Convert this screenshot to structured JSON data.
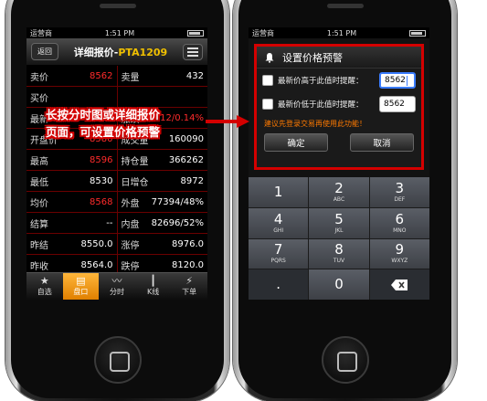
{
  "left_phone": {
    "status": {
      "carrier": "运营商",
      "time": "1:51 PM"
    },
    "header": {
      "back_label": "返回",
      "title_prefix": "详细报价-",
      "title_code": "PTA1209"
    },
    "rows": [
      {
        "l_label": "卖价",
        "l_value": "8562",
        "l_red": true,
        "r_label": "卖量",
        "r_value": "432"
      },
      {
        "l_label": "买价",
        "l_value": "",
        "l_red": false,
        "r_label": "",
        "r_value": ""
      },
      {
        "l_label": "最新",
        "l_value": "8562",
        "l_red": true,
        "r_label": "涨跌",
        "r_value": "12/0.14%"
      },
      {
        "l_label": "开盘价",
        "l_value": "8580",
        "l_red": true,
        "r_label": "成交量",
        "r_value": "160090"
      },
      {
        "l_label": "最高",
        "l_value": "8596",
        "l_red": true,
        "r_label": "持仓量",
        "r_value": "366262"
      },
      {
        "l_label": "最低",
        "l_value": "8530",
        "l_red": false,
        "r_label": "日增仓",
        "r_value": "8972"
      },
      {
        "l_label": "均价",
        "l_value": "8568",
        "l_red": true,
        "r_label": "外盘",
        "r_value": "77394/48%"
      },
      {
        "l_label": "结算",
        "l_value": "--",
        "l_red": false,
        "r_label": "内盘",
        "r_value": "82696/52%"
      },
      {
        "l_label": "昨结",
        "l_value": "8550.0",
        "l_red": false,
        "r_label": "涨停",
        "r_value": "8976.0"
      },
      {
        "l_label": "昨收",
        "l_value": "8564.0",
        "l_red": false,
        "r_label": "跌停",
        "r_value": "8120.0"
      }
    ],
    "tabs": [
      {
        "label": "自选",
        "icon": "star-icon",
        "glyph": "★"
      },
      {
        "label": "盘口",
        "icon": "list-icon",
        "glyph": "▤"
      },
      {
        "label": "分时",
        "icon": "line-chart-icon",
        "glyph": "〰"
      },
      {
        "label": "K线",
        "icon": "candlestick-icon",
        "glyph": "┃"
      },
      {
        "label": "下单",
        "icon": "lightning-icon",
        "glyph": "⚡"
      }
    ],
    "selected_tab": 1
  },
  "callout": {
    "line1": "长按分时图或详细报价",
    "line2": "页面，可设置价格预警"
  },
  "right_phone": {
    "status": {
      "carrier": "运营商",
      "time": "1:51 PM"
    },
    "dialog": {
      "title": "设置价格预警",
      "high_label": "最新价高于此值时提醒：",
      "high_value": "8562",
      "low_label": "最新价低于此值时提醒：",
      "low_value": "8562",
      "warning": "建议先登录交易再使用此功能！",
      "ok_label": "确定",
      "cancel_label": "取消"
    },
    "keys": [
      {
        "num": "1",
        "letters": ""
      },
      {
        "num": "2",
        "letters": "ABC"
      },
      {
        "num": "3",
        "letters": "DEF"
      },
      {
        "num": "4",
        "letters": "GHI"
      },
      {
        "num": "5",
        "letters": "JKL"
      },
      {
        "num": "6",
        "letters": "MNO"
      },
      {
        "num": "7",
        "letters": "PQRS"
      },
      {
        "num": "8",
        "letters": "TUV"
      },
      {
        "num": "9",
        "letters": "WXYZ"
      },
      {
        "num": ".",
        "letters": ""
      },
      {
        "num": "0",
        "letters": ""
      },
      {
        "num": "",
        "letters": ""
      }
    ]
  },
  "colors": {
    "accent_red": "#d40000",
    "price_red": "#ff2b2b",
    "tab_orange": "#f0a020",
    "code_yellow": "#f0c000",
    "warning_orange": "#ff7a00"
  }
}
